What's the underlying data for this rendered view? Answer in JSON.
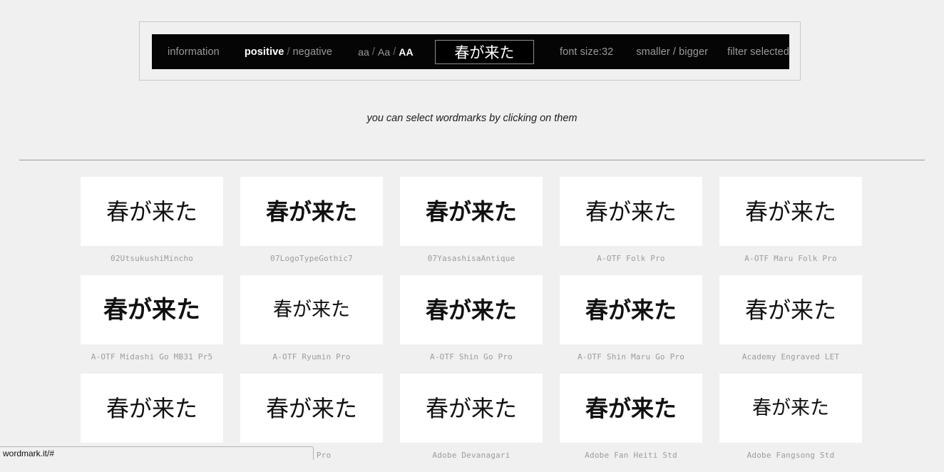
{
  "toolbar": {
    "information_label": "information",
    "positive_label": "positive",
    "slash_1": "/",
    "negative_label": "negative",
    "case_aa_lower": "aa",
    "case_slash_1": "/",
    "case_aa_title": "Aa",
    "case_slash_2": "/",
    "case_aa_upper": "AA",
    "preview_text": "春が来た",
    "preview_placeholder": "春が来た",
    "font_size_label": "font size:32",
    "smaller_bigger_label": "smaller / bigger",
    "filter_selected_label": "filter selected"
  },
  "subtitle": "you can select wordmarks by clicking on them",
  "sample_text": "春が来た",
  "grid": {
    "items": [
      {
        "sample": "春が来た",
        "name": "02UtsukushiMincho",
        "style": "serif"
      },
      {
        "sample": "春が来た",
        "name": "07LogoTypeGothic7",
        "style": "bold"
      },
      {
        "sample": "春が来た",
        "name": "07YasashisaAntique",
        "style": "bold"
      },
      {
        "sample": "春が来た",
        "name": "A-OTF Folk Pro",
        "style": ""
      },
      {
        "sample": "春が来た",
        "name": "A-OTF Maru Folk Pro",
        "style": ""
      },
      {
        "sample": "春が来た",
        "name": "A-OTF Midashi Go MB31 Pr5",
        "style": "bold lg"
      },
      {
        "sample": "春が来た",
        "name": "A-OTF Ryumin Pro",
        "style": "serif sm"
      },
      {
        "sample": "春が来た",
        "name": "A-OTF Shin Go Pro",
        "style": "bold"
      },
      {
        "sample": "春が来た",
        "name": "A-OTF Shin Maru Go Pro",
        "style": "bold"
      },
      {
        "sample": "春が来た",
        "name": "Academy Engraved LET",
        "style": ""
      },
      {
        "sample": "春が来た",
        "name": "",
        "style": ""
      },
      {
        "sample": "春が来た",
        "name": "slon Pro",
        "style": ""
      },
      {
        "sample": "春が来た",
        "name": "Adobe Devanagari",
        "style": ""
      },
      {
        "sample": "春が来た",
        "name": "Adobe Fan Heiti Std",
        "style": "bold"
      },
      {
        "sample": "春が来た",
        "name": "Adobe Fangsong Std",
        "style": "serif sm"
      }
    ]
  },
  "statusbar": {
    "url": "wordmark.it/#"
  }
}
